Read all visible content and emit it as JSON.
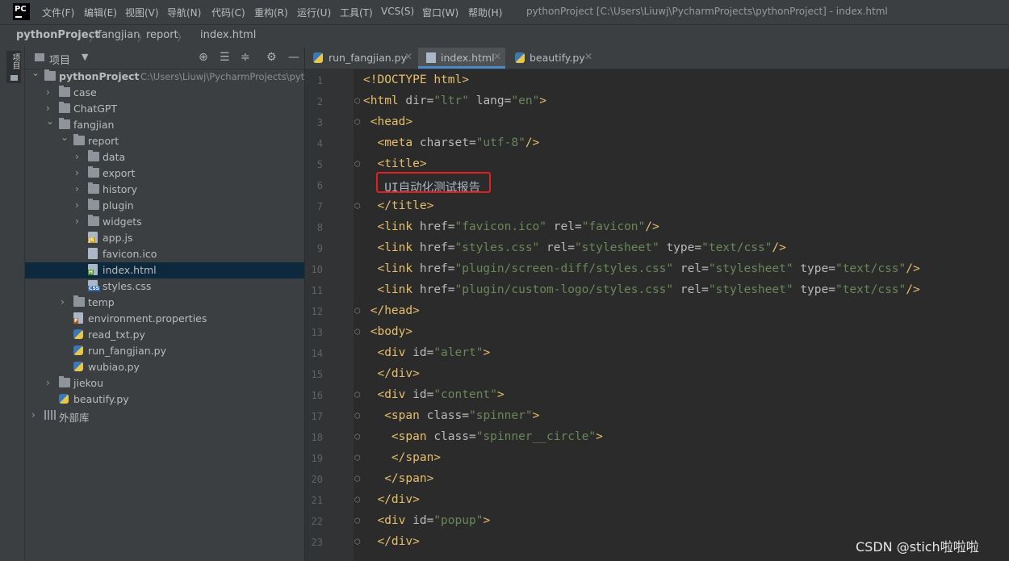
{
  "window": {
    "app_logo": "PC",
    "title": "pythonProject [C:\\Users\\Liuwj\\PycharmProjects\\pythonProject] - index.html",
    "menu": [
      "文件(F)",
      "编辑(E)",
      "视图(V)",
      "导航(N)",
      "代码(C)",
      "重构(R)",
      "运行(U)",
      "工具(T)",
      "VCS(S)",
      "窗口(W)",
      "帮助(H)"
    ]
  },
  "breadcrumb": [
    "pythonProject",
    "fangjian",
    "report",
    "index.html"
  ],
  "side_strip": {
    "tab_label": "项目"
  },
  "project_panel": {
    "header_label": "项目",
    "header_icons": [
      "crosshair-icon",
      "collapse-all-icon",
      "expand-all-icon",
      "gear-icon",
      "minimize-icon"
    ],
    "tree": [
      {
        "label": "pythonProject",
        "path": "C:\\Users\\Liuwj\\PycharmProjects\\pyth",
        "icon": "folder-icon",
        "expanded": true,
        "bold": true
      },
      {
        "label": "case",
        "icon": "folder-icon",
        "expanded": false
      },
      {
        "label": "ChatGPT",
        "icon": "folder-icon",
        "expanded": false
      },
      {
        "label": "fangjian",
        "icon": "folder-icon",
        "expanded": true
      },
      {
        "label": "report",
        "icon": "folder-icon",
        "expanded": true
      },
      {
        "label": "data",
        "icon": "folder-icon",
        "expanded": false
      },
      {
        "label": "export",
        "icon": "folder-icon",
        "expanded": false
      },
      {
        "label": "history",
        "icon": "folder-icon",
        "expanded": false
      },
      {
        "label": "plugin",
        "icon": "folder-icon",
        "expanded": false
      },
      {
        "label": "widgets",
        "icon": "folder-icon",
        "expanded": false
      },
      {
        "label": "app.js",
        "icon": "js-file-icon"
      },
      {
        "label": "favicon.ico",
        "icon": "image-file-icon"
      },
      {
        "label": "index.html",
        "icon": "html-file-icon",
        "selected": true
      },
      {
        "label": "styles.css",
        "icon": "css-file-icon"
      },
      {
        "label": "temp",
        "icon": "folder-icon",
        "expanded": false
      },
      {
        "label": "environment.properties",
        "icon": "properties-file-icon"
      },
      {
        "label": "read_txt.py",
        "icon": "python-file-icon"
      },
      {
        "label": "run_fangjian.py",
        "icon": "python-file-icon"
      },
      {
        "label": "wubiao.py",
        "icon": "python-file-icon"
      },
      {
        "label": "jiekou",
        "icon": "folder-icon",
        "expanded": false
      },
      {
        "label": "beautify.py",
        "icon": "python-file-icon"
      },
      {
        "label": "外部库",
        "icon": "library-icon",
        "expanded": false
      }
    ]
  },
  "editor_tabs": [
    {
      "label": "run_fangjian.py",
      "icon": "python-file-icon",
      "active": false
    },
    {
      "label": "index.html",
      "icon": "html-file-icon",
      "active": true
    },
    {
      "label": "beautify.py",
      "icon": "python-file-icon",
      "active": false
    }
  ],
  "code_lines": [
    "<!DOCTYPE html>",
    "<html dir=\"ltr\" lang=\"en\">",
    " <head>",
    "  <meta charset=\"utf-8\"/>",
    "  <title>",
    "   UI自动化测试报告",
    "  </title>",
    "  <link href=\"favicon.ico\" rel=\"favicon\"/>",
    "  <link href=\"styles.css\" rel=\"stylesheet\" type=\"text/css\"/>",
    "  <link href=\"plugin/screen-diff/styles.css\" rel=\"stylesheet\" type=\"text/css\"/>",
    "  <link href=\"plugin/custom-logo/styles.css\" rel=\"stylesheet\" type=\"text/css\"/>",
    " </head>",
    " <body>",
    "  <div id=\"alert\">",
    "  </div>",
    "  <div id=\"content\">",
    "   <span class=\"spinner\">",
    "    <span class=\"spinner__circle\">",
    "    </span>",
    "   </span>",
    "  </div>",
    "  <div id=\"popup\">",
    "  </div>"
  ],
  "highlighted_text": "UI自动化测试报告",
  "watermark": "CSDN @stich啦啦啦"
}
